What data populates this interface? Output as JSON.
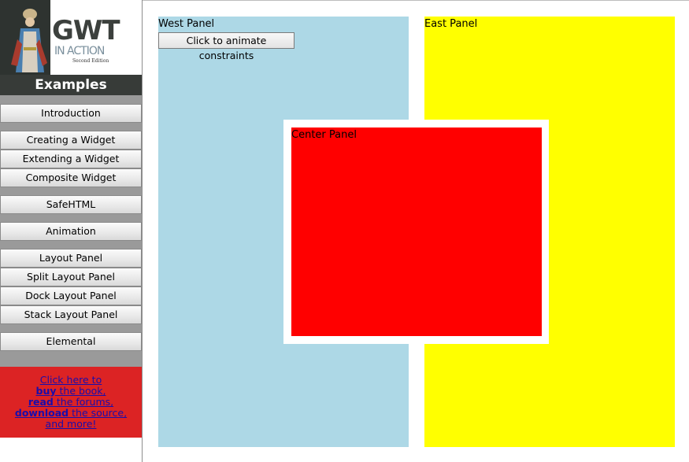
{
  "logo": {
    "title": "GWT",
    "subtitle": "IN ACTION",
    "edition": "Second Edition"
  },
  "sidebar": {
    "heading": "Examples",
    "items": [
      {
        "label": "Introduction"
      },
      {
        "label": "Creating a Widget"
      },
      {
        "label": "Extending a Widget"
      },
      {
        "label": "Composite Widget"
      },
      {
        "label": "SafeHTML"
      },
      {
        "label": "Animation"
      },
      {
        "label": "Layout Panel"
      },
      {
        "label": "Split Layout Panel"
      },
      {
        "label": "Dock Layout Panel"
      },
      {
        "label": "Stack Layout Panel"
      },
      {
        "label": "Elemental"
      }
    ],
    "promo": {
      "line1": "Click here to",
      "buy": "buy",
      "buy_rest": " the book,",
      "read": "read",
      "read_rest": " the forums,",
      "download": "download",
      "download_rest": " the source,",
      "line5": "and more!"
    }
  },
  "panels": {
    "west_label": "West Panel",
    "east_label": "East Panel",
    "center_label": "Center Panel",
    "animate_button": "Click to animate constraints"
  },
  "colors": {
    "west": "#add8e6",
    "east": "#ffff00",
    "center": "#ff0000",
    "promo": "#dc2324",
    "nav_bg": "#9a9a9a"
  }
}
